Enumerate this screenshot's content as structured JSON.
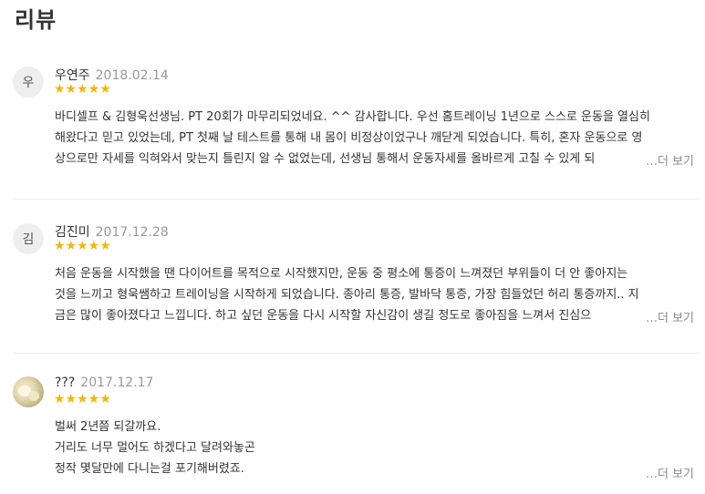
{
  "title": "리뷰",
  "more_label": "…더 보기",
  "star_glyphs": "★★★★★",
  "rating_color": "#f2b705",
  "reviews": [
    {
      "avatar_text": "우",
      "author": "우연주",
      "date": "2018.02.14",
      "rating": 5,
      "lines": [
        "바디셀프 & 김형욱선생님. PT 20회가 마무리되었네요. ^^ 감사합니다. 우선 홈트레이닝 1년으로 스스로 운동을 열심히",
        "해왔다고 믿고 있었는데, PT 첫째 날 테스트를 통해 내 몸이 비정상이었구나 깨닫게 되었습니다. 특히, 혼자 운동으로 영",
        "상으로만 자세를 익혀와서 맞는지 틀린지 알 수 없었는데, 선생님 통해서 운동자세를 올바르게 고칠 수 있게 되"
      ]
    },
    {
      "avatar_text": "김",
      "author": "김진미",
      "date": "2017.12.28",
      "rating": 5,
      "lines": [
        "처음 운동을 시작했을 땐 다이어트를 목적으로 시작했지만, 운동 중 평소에 통증이 느껴졌던 부위들이 더 안 좋아지는",
        "것을 느끼고 형욱쌤하고 트레이닝을 시작하게 되었습니다. 종아리 통증, 발바닥 통증, 가장 힘들었던 허리 통증까지.. 지",
        "금은 많이 좋아졌다고 느낍니다. 하고 싶던 운동을 다시 시작할 자신감이 생길 정도로 좋아짐을 느껴서 진심으"
      ]
    },
    {
      "avatar_text": "",
      "author": "???",
      "date": "2017.12.17",
      "rating": 5,
      "lines": [
        "벌써 2년쯤 되갈까요.",
        "거리도 너무 멀어도 하겠다고 달려와놓곤",
        "정작 몇달만에 다니는걸 포기해버렸죠."
      ]
    }
  ]
}
